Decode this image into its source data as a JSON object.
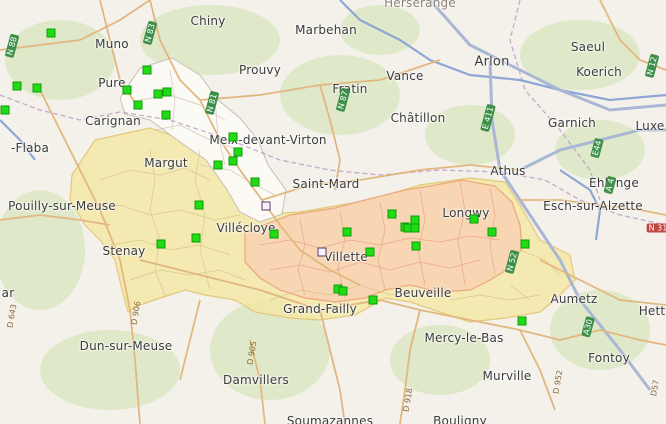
{
  "map": {
    "colors": {
      "background": "#f4f1ea",
      "forest": "#dfe9c9",
      "yellow_region": "#f3e7a6",
      "orange_region": "#f8d3b4",
      "white_region": "#fbfaf6",
      "river": "#8ea7d4",
      "motorway": "#a9b7d4",
      "main_road": "#e2b77f",
      "boundary": "#b7aaa3",
      "marker_filled": "#1fdc14",
      "marker_open": "#f6f3ff"
    },
    "places": [
      {
        "name": "Herserange"
      },
      {
        "name": "Chiny"
      },
      {
        "name": "Marbehan"
      },
      {
        "name": "Saeul"
      },
      {
        "name": "Muno"
      },
      {
        "name": "Arlon"
      },
      {
        "name": "Koerich"
      },
      {
        "name": "Prouvy"
      },
      {
        "name": "Vance"
      },
      {
        "name": "Fratin"
      },
      {
        "name": "Pure"
      },
      {
        "name": "Carignan"
      },
      {
        "name": "Châtillon"
      },
      {
        "name": "Garnich"
      },
      {
        "name": "Luxe"
      },
      {
        "name": "-Flaba"
      },
      {
        "name": "Meix-devant-Virton"
      },
      {
        "name": "Margut"
      },
      {
        "name": "Athus"
      },
      {
        "name": "Saint-Mard"
      },
      {
        "name": "Ehlange"
      },
      {
        "name": "Pouilly-sur-Meuse"
      },
      {
        "name": "Longwy"
      },
      {
        "name": "Esch-sur-Alzette"
      },
      {
        "name": "Villécloye"
      },
      {
        "name": "Stenay"
      },
      {
        "name": "Villette"
      },
      {
        "name": "ar"
      },
      {
        "name": "Beuveille"
      },
      {
        "name": "Aumetz"
      },
      {
        "name": "Grand-Failly"
      },
      {
        "name": "Hett"
      },
      {
        "name": "Dun-sur-Meuse"
      },
      {
        "name": "Mercy-le-Bas"
      },
      {
        "name": "Fontoy"
      },
      {
        "name": "Murville"
      },
      {
        "name": "Damvillers"
      },
      {
        "name": "Soumazannes"
      },
      {
        "name": "Bouligny"
      }
    ],
    "road_shields": [
      {
        "ref": "N 88"
      },
      {
        "ref": "N 83"
      },
      {
        "ref": "N 81"
      },
      {
        "ref": "N 87"
      },
      {
        "ref": "E 411"
      },
      {
        "ref": "A 4"
      },
      {
        "ref": "E44"
      },
      {
        "ref": "N 12"
      },
      {
        "ref": "N 31"
      },
      {
        "ref": "N 52"
      },
      {
        "ref": "A30"
      },
      {
        "ref": "D57"
      },
      {
        "ref": "D 918"
      },
      {
        "ref": "D 952"
      },
      {
        "ref": "D 905"
      },
      {
        "ref": "D 906"
      },
      {
        "ref": "D 643"
      }
    ]
  }
}
